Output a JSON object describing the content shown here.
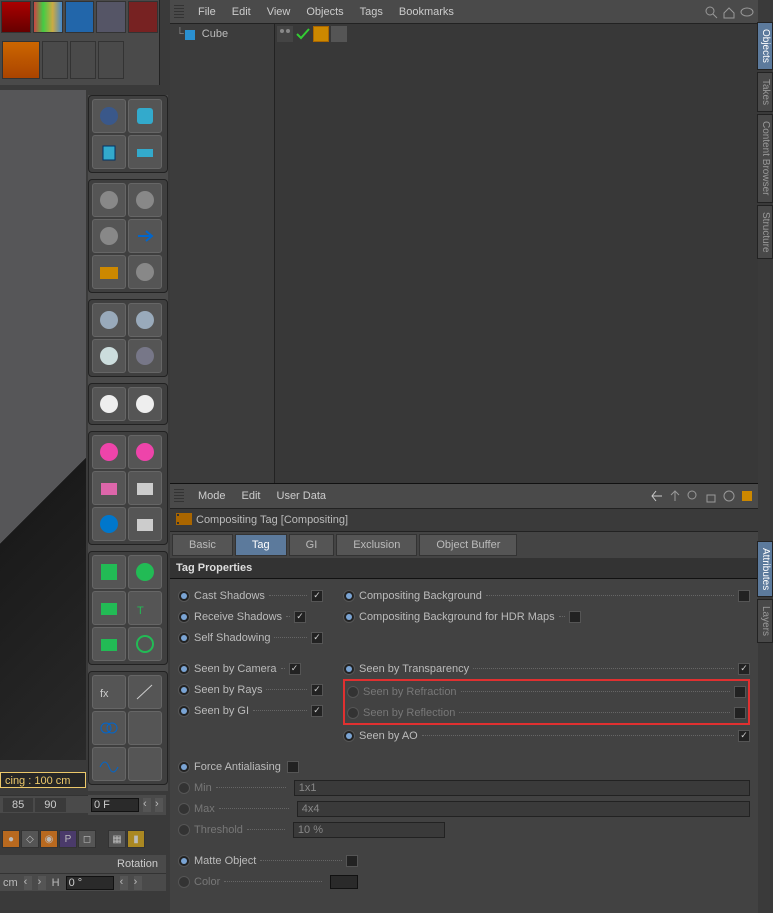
{
  "top_toolbar_icons": [
    "arrow-down",
    "swatches",
    "v-tool",
    "x-tool",
    "warrior"
  ],
  "obj_menubar": [
    "File",
    "Edit",
    "View",
    "Objects",
    "Tags",
    "Bookmarks"
  ],
  "objects": {
    "name": "Cube"
  },
  "attr_menubar": [
    "Mode",
    "Edit",
    "User Data"
  ],
  "attr_header": "Compositing Tag [Compositing]",
  "tabs": [
    "Basic",
    "Tag",
    "GI",
    "Exclusion",
    "Object Buffer"
  ],
  "active_tab": "Tag",
  "section": "Tag Properties",
  "props_left": [
    {
      "label": "Cast Shadows",
      "checked": true,
      "enabled": true
    },
    {
      "label": "Receive Shadows",
      "checked": true,
      "enabled": true
    },
    {
      "label": "Self Shadowing",
      "checked": true,
      "enabled": true
    }
  ],
  "props_left2": [
    {
      "label": "Seen by Camera",
      "checked": true,
      "enabled": true
    },
    {
      "label": "Seen by Rays",
      "checked": true,
      "enabled": true
    },
    {
      "label": "Seen by GI",
      "checked": true,
      "enabled": true
    }
  ],
  "props_right": [
    {
      "label": "Compositing Background",
      "checked": false,
      "enabled": true
    },
    {
      "label": "Compositing Background for HDR Maps",
      "checked": false,
      "enabled": true
    }
  ],
  "props_right2": [
    {
      "label": "Seen by Transparency",
      "checked": true,
      "enabled": true
    },
    {
      "label": "Seen by Refraction",
      "checked": false,
      "enabled": false
    },
    {
      "label": "Seen by Reflection",
      "checked": false,
      "enabled": false
    },
    {
      "label": "Seen by AO",
      "checked": true,
      "enabled": true
    }
  ],
  "force_aa": {
    "label": "Force Antialiasing",
    "checked": false
  },
  "aa_params": {
    "min_label": "Min",
    "min_value": "1x1",
    "max_label": "Max",
    "max_value": "4x4",
    "threshold_label": "Threshold",
    "threshold_value": "10 %"
  },
  "matte": {
    "label": "Matte Object",
    "checked": false,
    "color_label": "Color"
  },
  "edge_tabs": [
    "Objects",
    "Takes",
    "Content Browser",
    "Structure",
    "Attributes",
    "Layers"
  ],
  "status": "cing : 100 cm",
  "axis": {
    "x": "85",
    "y": "90"
  },
  "temp": "0 F",
  "rotation_label": "Rotation",
  "unit": "cm",
  "H_label": "H",
  "H_value": "0 °"
}
